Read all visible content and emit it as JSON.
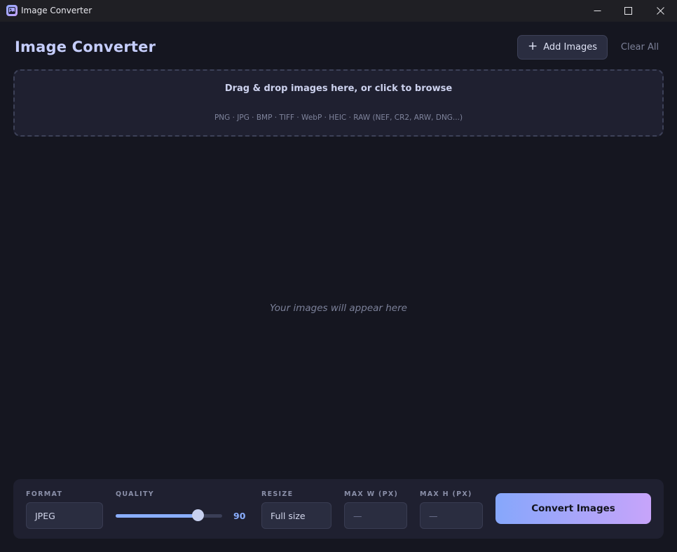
{
  "window": {
    "title": "Image Converter"
  },
  "header": {
    "title": "Image Converter",
    "add_label": "Add Images",
    "clear_label": "Clear All"
  },
  "dropzone": {
    "main_text": "Drag & drop images here, or click to browse",
    "formats_text": "PNG · JPG · BMP · TIFF · WebP · HEIC · RAW (NEF, CR2, ARW, DNG...)"
  },
  "empty_state": {
    "text": "Your images will appear here"
  },
  "controls": {
    "format": {
      "label": "FORMAT",
      "value": "JPEG"
    },
    "quality": {
      "label": "QUALITY",
      "value": 90,
      "min": 0,
      "max": 100
    },
    "resize": {
      "label": "RESIZE",
      "value": "Full size"
    },
    "max_w": {
      "label": "MAX W (PX)",
      "placeholder": "—"
    },
    "max_h": {
      "label": "MAX H (PX)",
      "placeholder": "—"
    },
    "convert_label": "Convert Images"
  },
  "colors": {
    "background": "#151620",
    "panel": "#1f2030",
    "accent": "#8aaeff",
    "accent_end": "#c7a4fa",
    "title": "#c5cdfc"
  }
}
